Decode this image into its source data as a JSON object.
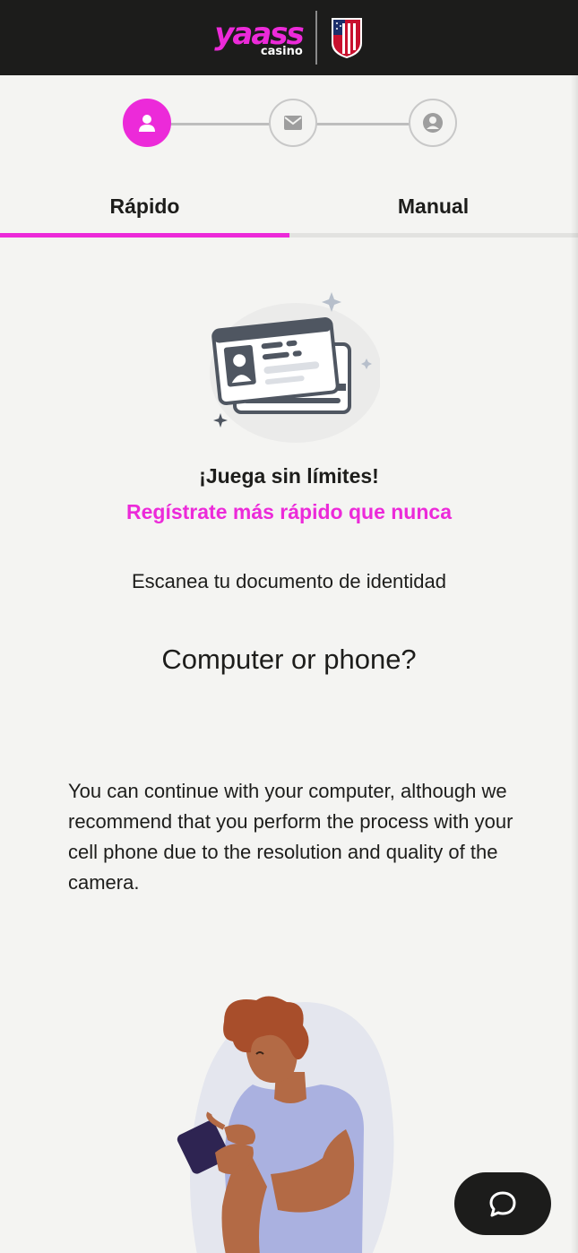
{
  "header": {
    "brand_word": "yaass",
    "brand_sub": "casino",
    "partner_crest_icon": "atletico-crest-icon"
  },
  "stepper": {
    "steps": [
      {
        "icon": "user-icon",
        "state": "active"
      },
      {
        "icon": "envelope-icon",
        "state": "inactive"
      },
      {
        "icon": "user-circle-icon",
        "state": "inactive"
      }
    ]
  },
  "tabs": [
    {
      "label": "Rápido",
      "selected": true
    },
    {
      "label": "Manual",
      "selected": false
    }
  ],
  "content": {
    "illustration_icon": "id-cards-icon",
    "headline": "¡Juega sin límites!",
    "subheadline": "Regístrate más rápido que nunca",
    "instruction": "Escanea tu documento de identidad",
    "question": "Computer or phone?",
    "body": "You can continue with your computer, although we recommend that you perform the process with your cell phone due to the resolution and quality of the camera.",
    "person_illustration_icon": "person-with-phone-icon"
  },
  "chat": {
    "icon": "chat-bubble-icon"
  },
  "colors": {
    "accent": "#ec2ad9",
    "header_bg": "#1c1c1b",
    "page_bg": "#f4f4f2",
    "inactive_gray": "#c8c8c8"
  }
}
